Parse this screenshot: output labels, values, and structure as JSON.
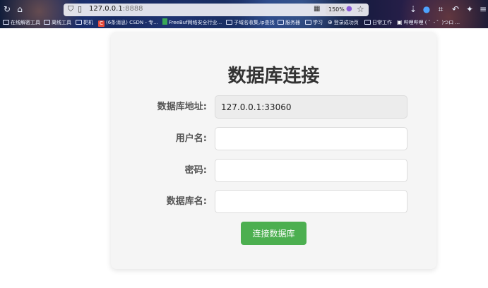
{
  "browser": {
    "url_host": "127.0.0.1",
    "url_port": ":8888",
    "zoom": "150%"
  },
  "bookmarks": [
    {
      "label": "在线解密工具",
      "icon": "folder-icon"
    },
    {
      "label": "离线工具",
      "icon": "folder-icon"
    },
    {
      "label": "靶机",
      "icon": "folder-icon"
    },
    {
      "label": "(6条消息) CSDN - 专...",
      "icon": "csdn-icon"
    },
    {
      "label": "FreeBuf网络安全行业...",
      "icon": "freebuf-icon"
    },
    {
      "label": "子域名收集,ip查找",
      "icon": "folder-icon"
    },
    {
      "label": "服务器",
      "icon": "folder-icon"
    },
    {
      "label": "学习",
      "icon": "folder-icon"
    },
    {
      "label": "登录成功页",
      "icon": "globe-icon"
    },
    {
      "label": "日常工作",
      "icon": "folder-icon"
    },
    {
      "label": "哔哩哔哩 ( ゜- ゜)つロ ...",
      "icon": "bilibili-icon"
    }
  ],
  "form": {
    "title": "数据库连接",
    "fields": [
      {
        "label": "数据库地址:",
        "value": "127.0.0.1:33060",
        "readonly": true
      },
      {
        "label": "用户名:",
        "value": ""
      },
      {
        "label": "密码:",
        "value": ""
      },
      {
        "label": "数据库名:",
        "value": ""
      }
    ],
    "submit_label": "连接数据库"
  },
  "colors": {
    "accent_green": "#4caf50",
    "title_text": "#333333",
    "label_text": "#555555",
    "card_bg": "#f5f5f5"
  }
}
